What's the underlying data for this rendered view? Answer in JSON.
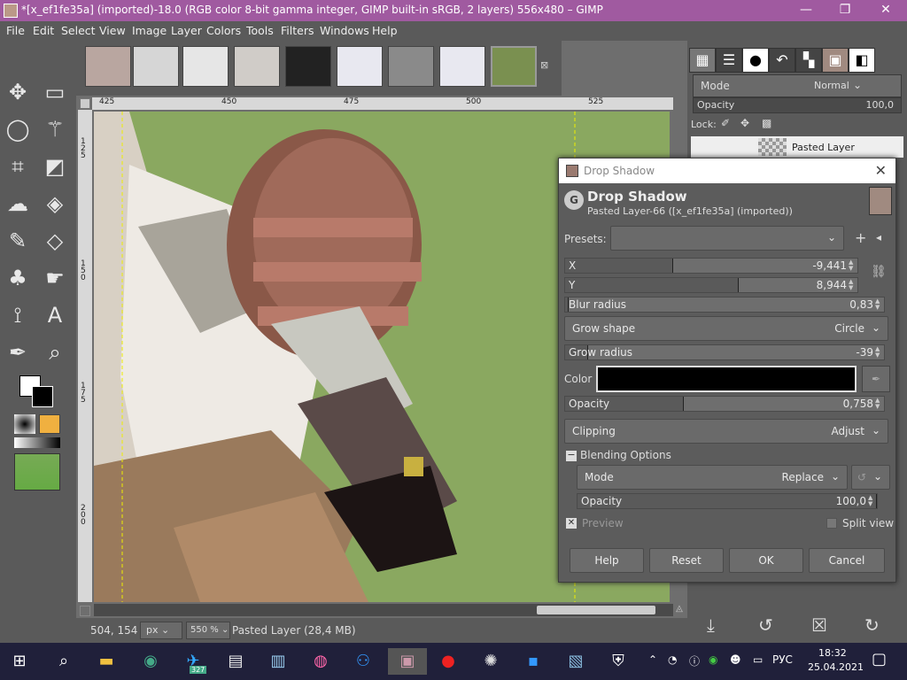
{
  "window": {
    "title": "*[x_ef1fe35a] (imported)-18.0 (RGB color 8-bit gamma integer, GIMP built-in sRGB, 2 layers) 556x480 – GIMP",
    "minimize": "—",
    "maximize": "❐",
    "close": "✕"
  },
  "menu": [
    "File",
    "Edit",
    "Select",
    "View",
    "Image",
    "Layer",
    "Colors",
    "Tools",
    "Filters",
    "Windows",
    "Help"
  ],
  "ruler_top": [
    "425",
    "450",
    "475",
    "500",
    "525"
  ],
  "ruler_left": [
    "1\n2\n5",
    "1\n5\n0",
    "1\n7\n5",
    "2\n0\n0"
  ],
  "status": {
    "coords": "504, 154",
    "unit": "px",
    "zoom": "550 %",
    "layer_info": "Pasted Layer (28,4 MB)"
  },
  "right_dock": {
    "mode_label": "Mode",
    "mode_value": "Normal",
    "opacity_label": "Opacity",
    "opacity_value": "100,0",
    "lock_label": "Lock:",
    "layer_name": "Pasted Layer"
  },
  "dialog": {
    "window_title": "Drop Shadow",
    "header_title": "Drop Shadow",
    "header_sub": "Pasted Layer-66 ([x_ef1fe35a] (imported))",
    "presets_label": "Presets:",
    "x_label": "X",
    "x_value": "-9,441",
    "y_label": "Y",
    "y_value": "8,944",
    "blur_label": "Blur radius",
    "blur_value": "0,83",
    "grow_shape_label": "Grow shape",
    "grow_shape_value": "Circle",
    "grow_radius_label": "Grow radius",
    "grow_radius_value": "-39",
    "color_label": "Color",
    "opacity_label": "Opacity",
    "opacity_value": "0,758",
    "clipping_label": "Clipping",
    "clipping_value": "Adjust",
    "blending_label": "Blending Options",
    "mode_label": "Mode",
    "mode_value": "Replace",
    "blend_opacity_label": "Opacity",
    "blend_opacity_value": "100,0",
    "preview_label": "Preview",
    "split_label": "Split view",
    "help": "Help",
    "reset": "Reset",
    "ok": "OK",
    "cancel": "Cancel"
  },
  "taskbar": {
    "telegram_badge": "327",
    "lang": "РУС",
    "time": "18:32",
    "date": "25.04.2021"
  },
  "colors": {
    "titlebar": "#a05aa0",
    "taskbar": "#20203a",
    "canvas_green": "#8aa860"
  }
}
